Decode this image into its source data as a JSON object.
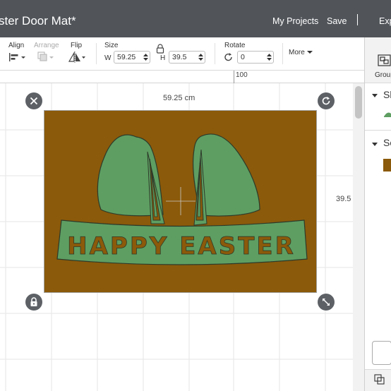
{
  "header": {
    "title": "ster Door Mat*",
    "my_projects": "My Projects",
    "save": "Save",
    "export_partial": "Exp"
  },
  "toolbar": {
    "align_label": "Align",
    "arrange_label": "Arrange",
    "flip_label": "Flip",
    "size_label": "Size",
    "width_prefix": "W",
    "width_value": "59.25",
    "height_prefix": "H",
    "height_value": "39.5",
    "rotate_label": "Rotate",
    "rotate_value": "0",
    "more_label": "More"
  },
  "ruler": {
    "mark": "100"
  },
  "canvas": {
    "width_readout": "59.25 cm",
    "height_readout": "39.5",
    "design_text": "HAPPY EASTER",
    "mat_color": "#8B5A0A",
    "shape_color": "#5E9E62",
    "outline_color": "#2D3A2A"
  },
  "panel": {
    "group_label": "Group",
    "section_1": "Sh",
    "section_2": "Se"
  },
  "colors": {
    "topbar": "#51555A",
    "accent_swatch": "#8B5A0A"
  },
  "icons": [
    "close-icon",
    "rotate-icon",
    "lock-icon",
    "resize-icon",
    "align-icon",
    "arrange-icon",
    "flip-icon",
    "rotate-small-icon",
    "group-icon",
    "layers-icon"
  ]
}
